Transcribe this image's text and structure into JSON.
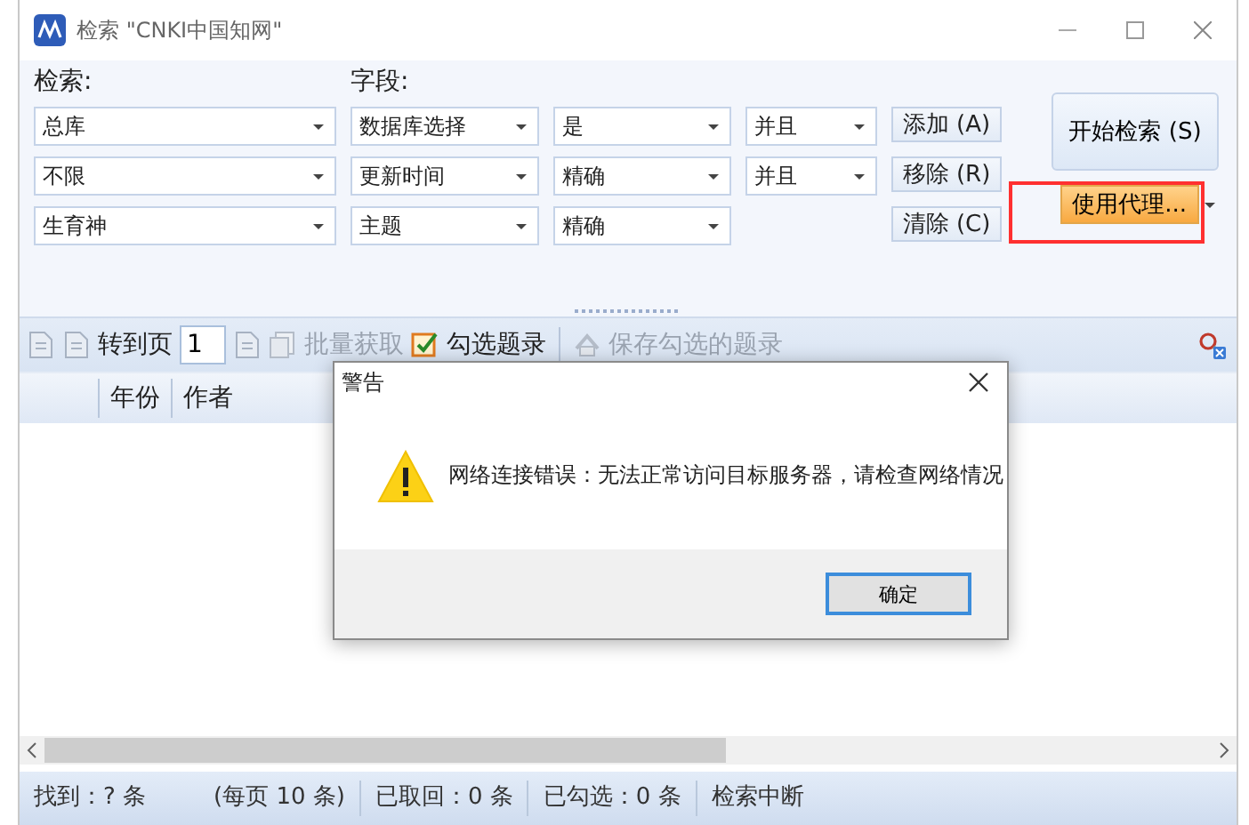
{
  "window": {
    "title": "检索 \"CNKI中国知网\""
  },
  "search": {
    "scope_label": "检索:",
    "field_label": "字段:",
    "rows": [
      {
        "scope": "总库",
        "field": "数据库选择",
        "match": "是",
        "logic": "并且"
      },
      {
        "scope": "不限",
        "field": "更新时间",
        "match": "精确",
        "logic": "并且"
      },
      {
        "scope": "生育神",
        "field": "主题",
        "match": "精确"
      }
    ],
    "side_buttons": [
      "添加 (A)",
      "移除 (R)",
      "清除 (C)"
    ],
    "start_button": "开始检索 (S)",
    "proxy_button": {
      "label": "使用代理...",
      "highlighted": true
    }
  },
  "toolbar": {
    "goto_label": "转到页",
    "page": "1",
    "items": [
      {
        "label": "批量获取",
        "disabled": true,
        "kind": "copy"
      },
      {
        "label": "勾选题录",
        "disabled": false,
        "kind": "check"
      },
      {
        "label": "保存勾选的题录",
        "disabled": true,
        "kind": "save"
      }
    ]
  },
  "table": {
    "columns": [
      "年份",
      "作者"
    ]
  },
  "status_bar": [
    "找到：? 条",
    "(每页 10 条)",
    "已取回：0 条",
    "已勾选：0 条",
    "检索中断"
  ],
  "dialog": {
    "title": "警告",
    "message": "网络连接错误：无法正常访问目标服务器，请检查网络情况",
    "button": "确定"
  }
}
